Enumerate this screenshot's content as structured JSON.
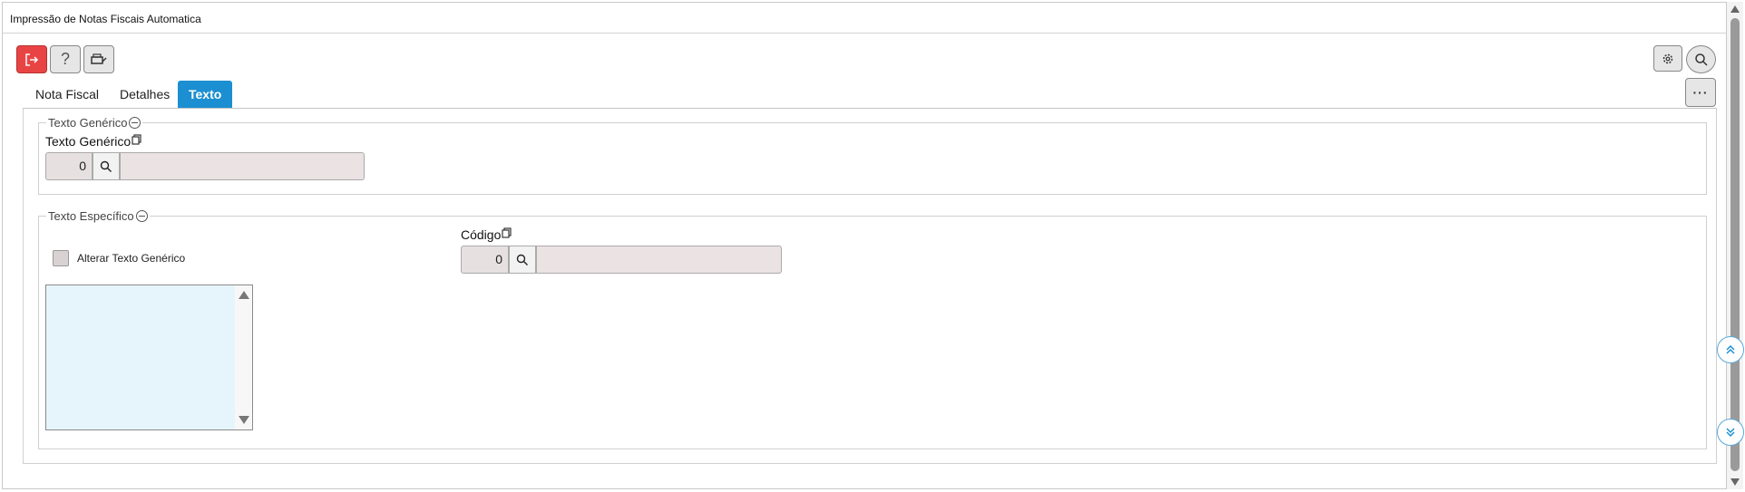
{
  "window": {
    "title": "Impressão de Notas Fiscais Automatica"
  },
  "toolbar": {
    "exit_icon": "exit-icon",
    "help_label": "?",
    "print_icon": "printer-icon",
    "settings_icon": "gear-icon",
    "search_icon": "search-icon",
    "more_label": "···"
  },
  "tabs": [
    {
      "label": "Nota Fiscal",
      "active": false
    },
    {
      "label": "Detalhes",
      "active": false
    },
    {
      "label": "Texto",
      "active": true
    }
  ],
  "generic_section": {
    "legend": "Texto Genérico",
    "field_label": "Texto Genérico",
    "code_value": "0",
    "description_value": ""
  },
  "specific_section": {
    "legend": "Texto Específico",
    "checkbox_label": "Alterar Texto Genérico",
    "checkbox_checked": false,
    "code_label": "Código",
    "code_value": "0",
    "description_value": "",
    "textarea_value": ""
  },
  "colors": {
    "accent": "#1b8fd1",
    "exit_button": "#e94444",
    "input_background": "#ebe2e4",
    "textarea_background": "#e6f5fc"
  }
}
